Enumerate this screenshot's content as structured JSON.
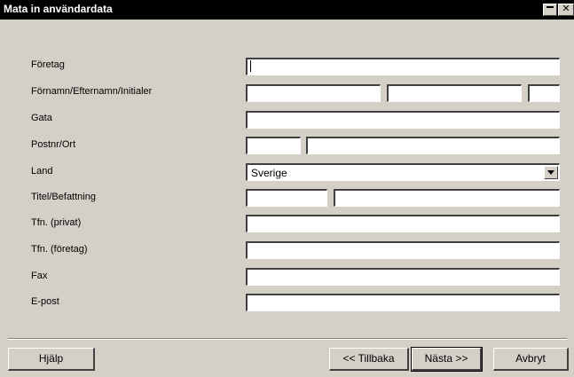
{
  "window": {
    "title": "Mata in användardata",
    "minimize_icon": "minimize-icon",
    "close_icon": "close-icon",
    "close_glyph": "✕"
  },
  "labels": {
    "foretag": "Företag",
    "namn": "Förnamn/Efternamn/Initialer",
    "gata": "Gata",
    "postnr": "Postnr/Ort",
    "land": "Land",
    "titel": "Titel/Befattning",
    "tfn_privat": "Tfn. (privat)",
    "tfn_foretag": "Tfn. (företag)",
    "fax": "Fax",
    "epost": "E-post"
  },
  "values": {
    "foretag": "",
    "fornamn": "",
    "efternamn": "",
    "initialer": "",
    "gata": "",
    "postnr": "",
    "ort": "",
    "land": "Sverige",
    "titel": "",
    "befattning": "",
    "tfn_privat": "",
    "tfn_foretag": "",
    "fax": "",
    "epost": ""
  },
  "buttons": {
    "help": "Hjälp",
    "back": "<< Tillbaka",
    "next": "Nästa >>",
    "cancel": "Avbryt"
  }
}
